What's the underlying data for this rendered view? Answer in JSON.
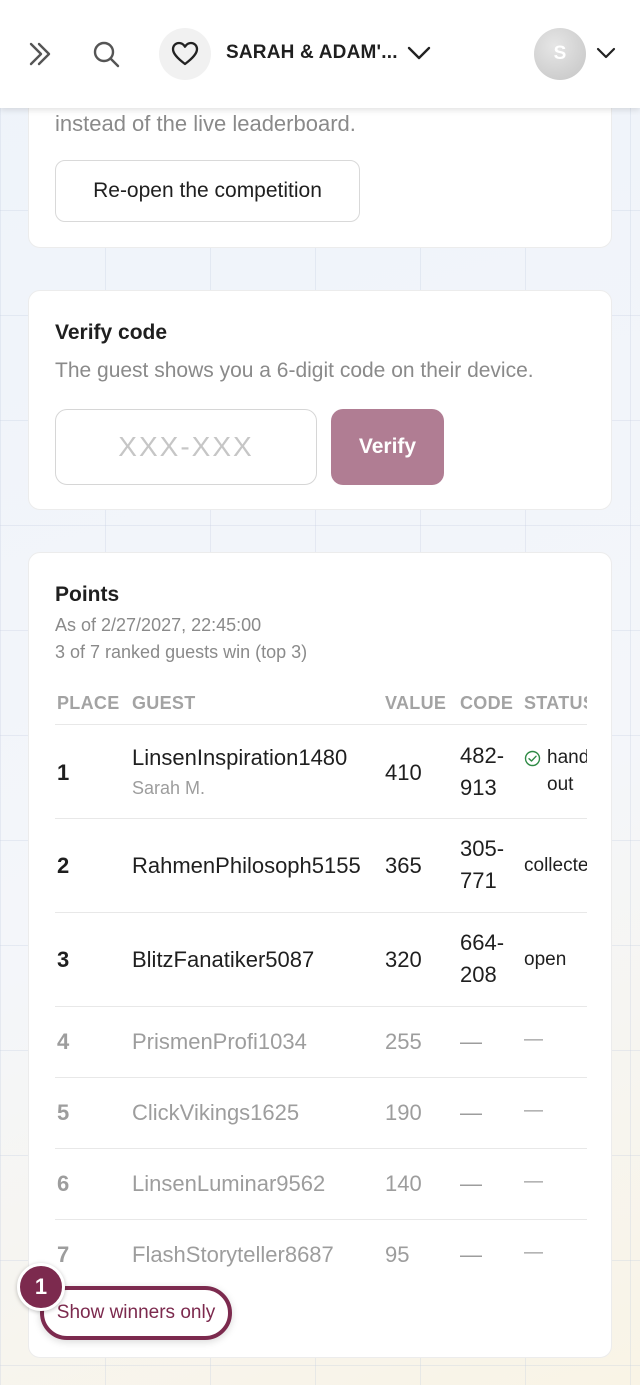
{
  "header": {
    "event_title": "SARAH & ADAM'...",
    "avatar_initial": "S"
  },
  "competition_card": {
    "clipped_text": "instead of the live leaderboard.",
    "reopen_label": "Re-open the competition"
  },
  "verify_card": {
    "title": "Verify code",
    "description": "The guest shows you a 6-digit code on their device.",
    "input_placeholder": "XXX-XXX",
    "verify_label": "Verify"
  },
  "points_card": {
    "title": "Points",
    "as_of": "As of 2/27/2027, 22:45:00",
    "ranked_summary": "3 of 7 ranked guests win (top 3)",
    "columns": [
      "PLACE",
      "GUEST",
      "VALUE",
      "CODE",
      "STATUS"
    ],
    "rows": [
      {
        "place": "1",
        "guest": "LinsenInspiration1480",
        "sub": "Sarah M.",
        "value": "410",
        "code": "482-913",
        "status": "handed out"
      },
      {
        "place": "2",
        "guest": "RahmenPhilosoph5155",
        "value": "365",
        "code": "305-771",
        "status": "collected"
      },
      {
        "place": "3",
        "guest": "BlitzFanatiker5087",
        "value": "320",
        "code": "664-208",
        "status": "open"
      },
      {
        "place": "4",
        "guest": "PrismenProfi1034",
        "value": "255",
        "code": "—",
        "status": "—"
      },
      {
        "place": "5",
        "guest": "ClickVikings1625",
        "value": "190",
        "code": "—",
        "status": "—"
      },
      {
        "place": "6",
        "guest": "LinsenLuminar9562",
        "value": "140",
        "code": "—",
        "status": "—"
      },
      {
        "place": "7",
        "guest": "FlashStoryteller8687",
        "value": "95",
        "code": "—",
        "status": "—"
      }
    ]
  },
  "floating": {
    "winners_label": "Show winners only",
    "badge_count": "1"
  },
  "colors": {
    "accent": "#7c2a4e",
    "verify_button": "#b07d93",
    "status_handed_out": "#2f8a45"
  },
  "icons": {
    "expand": "double-chevron-right-icon",
    "search": "search-icon",
    "event": "heart-icon",
    "event_menu": "chevron-down-icon",
    "avatar_menu": "chevron-down-icon",
    "status_handed_out": "check-circle-icon"
  }
}
